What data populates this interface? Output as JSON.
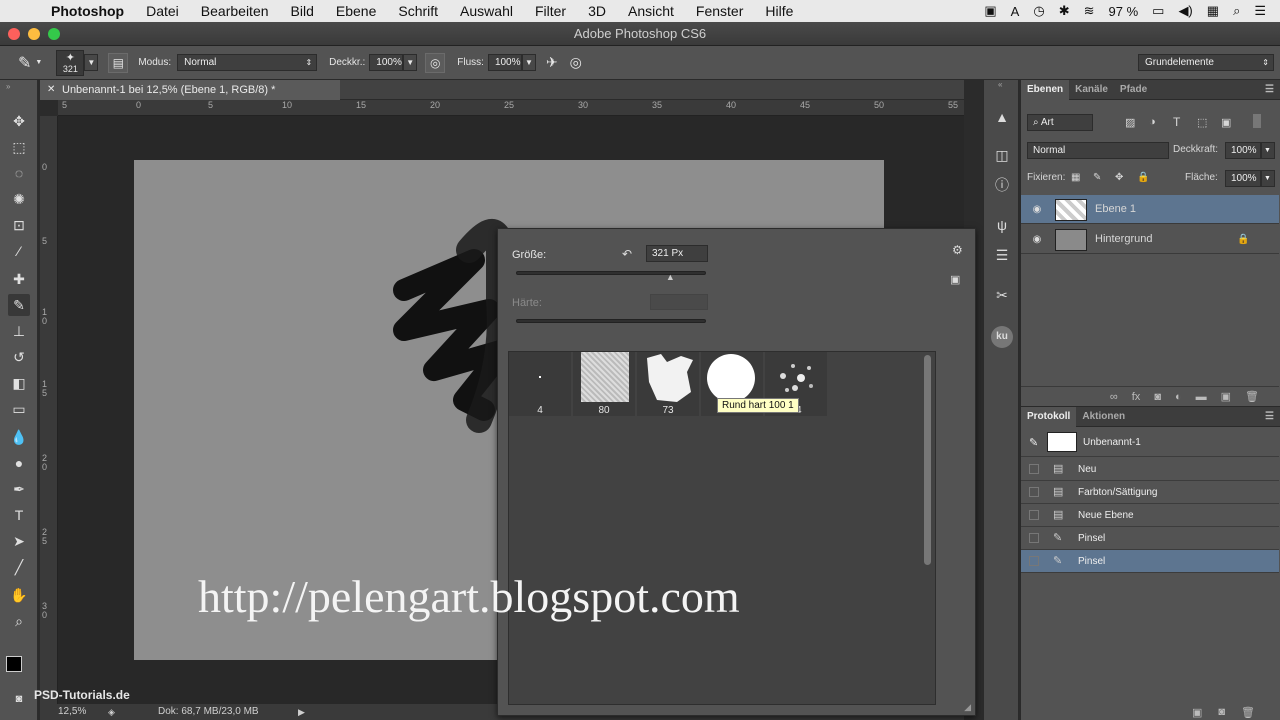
{
  "menubar": {
    "app": "Photoshop",
    "items": [
      "Datei",
      "Bearbeiten",
      "Bild",
      "Ebene",
      "Schrift",
      "Auswahl",
      "Filter",
      "3D",
      "Ansicht",
      "Fenster",
      "Hilfe"
    ],
    "battery": "97 %"
  },
  "window": {
    "title": "Adobe Photoshop CS6"
  },
  "options": {
    "brush_size": "321",
    "mode_label": "Modus:",
    "mode_value": "Normal",
    "opacity_label": "Deckkr.:",
    "opacity_value": "100%",
    "flow_label": "Fluss:",
    "flow_value": "100%",
    "workspace": "Grundelemente"
  },
  "document": {
    "tab_title": "Unbenannt-1 bei 12,5% (Ebene 1, RGB/8) *",
    "ruler_h": [
      "5",
      "0",
      "5",
      "10",
      "15",
      "20",
      "25",
      "30",
      "35",
      "40",
      "45",
      "50",
      "55"
    ],
    "ruler_v": [
      "0",
      "5",
      "1 0",
      "1 5",
      "2 0",
      "2 5",
      "3 0"
    ],
    "zoom": "12,5%",
    "doc_info": "Dok: 68,7 MB/23,0 MB"
  },
  "brush_popup": {
    "size_label": "Größe:",
    "size_value": "321 Px",
    "size_fraction": 0.81,
    "hardness_label": "Härte:",
    "presets": [
      {
        "num": "4"
      },
      {
        "num": "80"
      },
      {
        "num": "73"
      },
      {
        "num": "100"
      },
      {
        "num": "44"
      }
    ],
    "tooltip": "Rund hart 100 1"
  },
  "watermark": {
    "url": "http://pelengart.blogspot.com",
    "logo": "PSD-Tutorials.de"
  },
  "layers_panel": {
    "tabs": [
      "Ebenen",
      "Kanäle",
      "Pfade"
    ],
    "filter_kind": "Art",
    "blend_mode": "Normal",
    "opacity_label": "Deckkraft:",
    "opacity_value": "100%",
    "lock_label": "Fixieren:",
    "fill_label": "Fläche:",
    "fill_value": "100%",
    "layers": [
      {
        "name": "Ebene 1",
        "selected": true
      },
      {
        "name": "Hintergrund",
        "selected": false
      }
    ]
  },
  "history_panel": {
    "tabs": [
      "Protokoll",
      "Aktionen"
    ],
    "snapshot": "Unbenannt-1",
    "steps": [
      "Neu",
      "Farbton/Sättigung",
      "Neue Ebene",
      "Pinsel",
      "Pinsel"
    ]
  },
  "dock": {
    "ku_label": "ku"
  },
  "colors": {
    "selection_blue": "#5d7590",
    "panel_gray": "#535353",
    "canvas_gray": "#8e8e8e"
  }
}
